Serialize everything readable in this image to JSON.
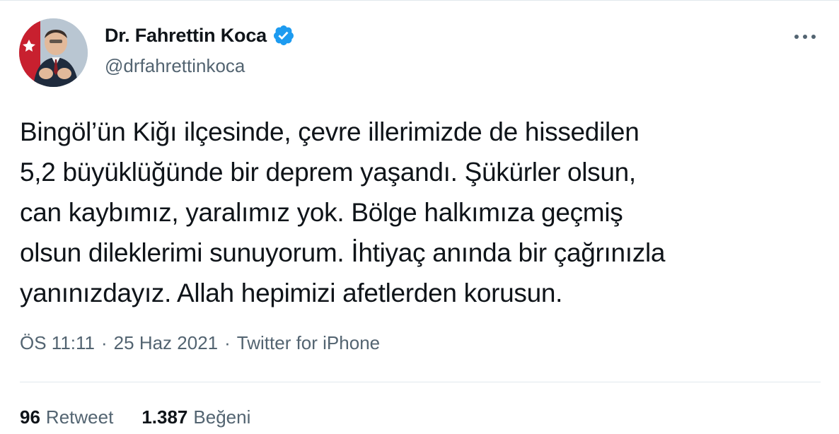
{
  "user": {
    "display_name": "Dr. Fahrettin Koca",
    "handle": "@drfahrettinkoca",
    "verified": true
  },
  "tweet": {
    "text": "Bingöl’ün Kiğı ilçesinde, çevre illerimizde de hissedilen\n5,2 büyüklüğünde bir deprem yaşandı. Şükürler olsun,\ncan kaybımız, yaralımız yok. Bölge halkımıza geçmiş\nolsun dileklerimi sunuyorum. İhtiyaç anında bir çağrınızla\nyanınızdayız. Allah hepimizi afetlerden korusun."
  },
  "meta": {
    "time": "ÖS 11:11",
    "separator": "·",
    "date": "25 Haz 2021",
    "source": "Twitter for iPhone"
  },
  "stats": {
    "retweets_count": "96",
    "retweets_label": "Retweet",
    "likes_count": "1.387",
    "likes_label": "Beğeni"
  },
  "colors": {
    "text_primary": "#0f1419",
    "text_secondary": "#536471",
    "verified_blue": "#1d9bf0",
    "divider": "#e1e8ed"
  },
  "icons": {
    "verified": "verified-badge-icon",
    "more": "more-horizontal-icon"
  }
}
